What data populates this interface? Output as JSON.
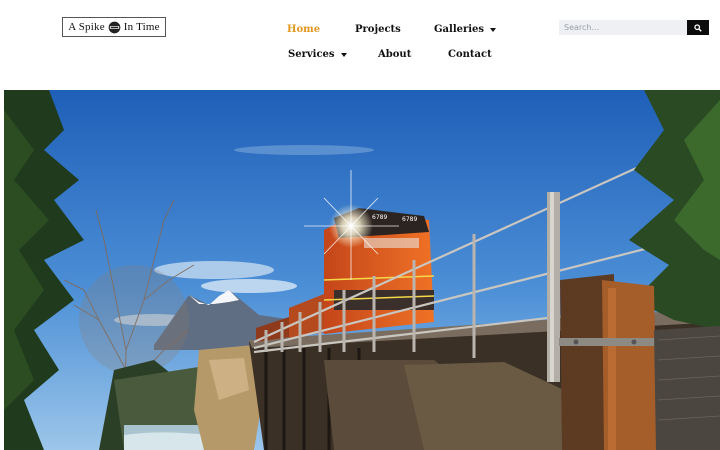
{
  "site": {
    "logo_left": "A Spike",
    "logo_right": "In Time"
  },
  "nav": {
    "items": [
      {
        "label": "Home",
        "active": true,
        "dropdown": false
      },
      {
        "label": "Projects",
        "active": false,
        "dropdown": false
      },
      {
        "label": "Galleries",
        "active": false,
        "dropdown": true
      },
      {
        "label": "Services",
        "active": false,
        "dropdown": true
      },
      {
        "label": "About",
        "active": false,
        "dropdown": false
      },
      {
        "label": "Contact",
        "active": false,
        "dropdown": false
      }
    ]
  },
  "search": {
    "placeholder": "Search...",
    "button_icon": "search-icon"
  },
  "hero": {
    "image_alt": "",
    "locomotive_number": "6789"
  },
  "colors": {
    "accent": "#e2961a",
    "text": "#111111",
    "search_bg": "#eef0f3",
    "search_button": "#0c0c0c"
  }
}
